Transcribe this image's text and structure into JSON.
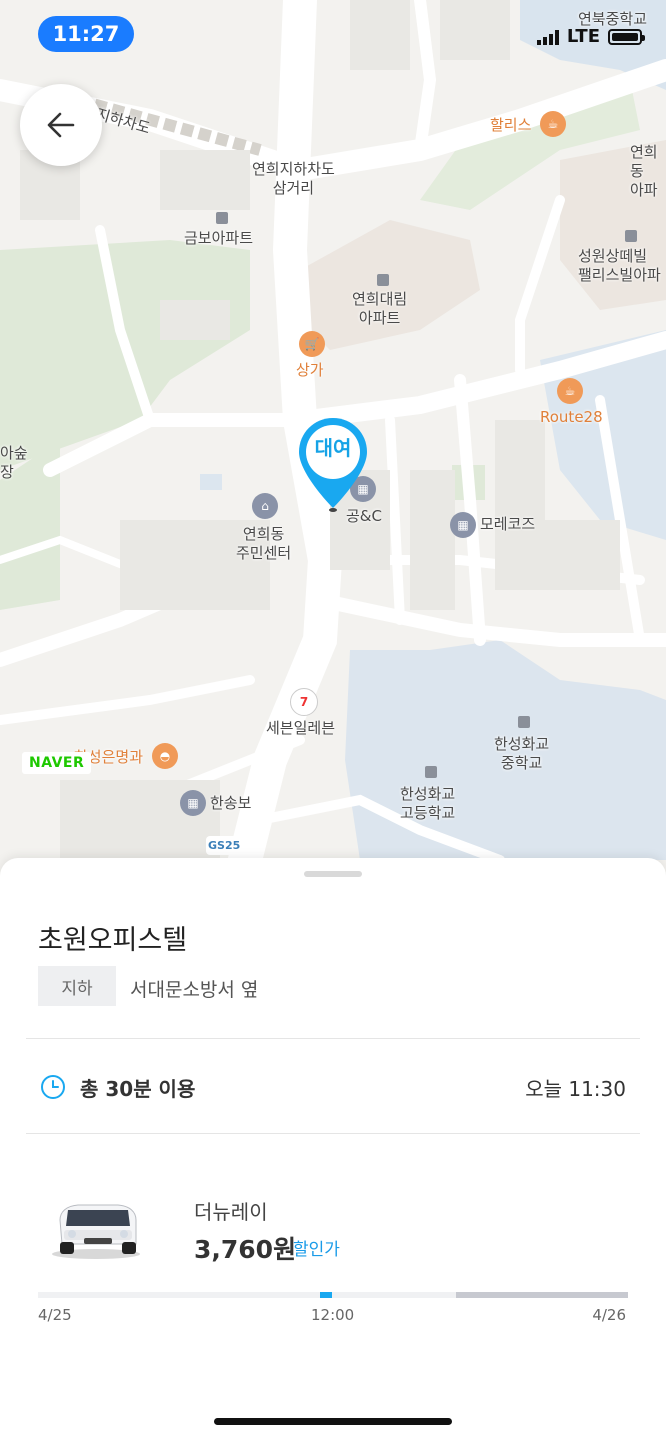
{
  "status_bar": {
    "time": "11:27",
    "network": "LTE"
  },
  "map": {
    "labels": {
      "underpass": "연희지하차도",
      "underpass_junction": "연희지하차도\n삼거리",
      "geumbo": "금보아파트",
      "daerim": "연희대림\n아파트",
      "sangga": "상가",
      "hollys": "할리스",
      "yeonbuk": "연북중학교",
      "yeonhui_right": "연희동\n아파",
      "seongwon": "성원상떼빌\n팰리스빌아파",
      "route28": "Route28",
      "forest": "아숲\n장",
      "gongnc": "공&C",
      "morecoz": "모레코즈",
      "community_center": "연희동\n주민센터",
      "seven_eleven": "세븐일레븐",
      "hansung_myeonggwa": "한성은명과",
      "hansungmiddle": "한성화교\n중학교",
      "hansunghigh": "한성화교\n고등학교",
      "hansongbo": "한송보",
      "gs25": "GS25"
    },
    "pin_label": "대여",
    "attribution": "NAVER"
  },
  "sheet": {
    "title": "초원오피스텔",
    "tag": "지하",
    "address": "서대문소방서 옆",
    "usage": "총 30분 이용",
    "today": "오늘 11:30",
    "car_name": "더뉴레이",
    "price": "3,760원",
    "discount_label": "할인가",
    "timeline": {
      "start": "4/25",
      "mid": "12:00",
      "end": "4/26"
    }
  },
  "colors": {
    "accent": "#19a8f0",
    "status_pill": "#1a7cff",
    "naver_green": "#1ec800"
  }
}
